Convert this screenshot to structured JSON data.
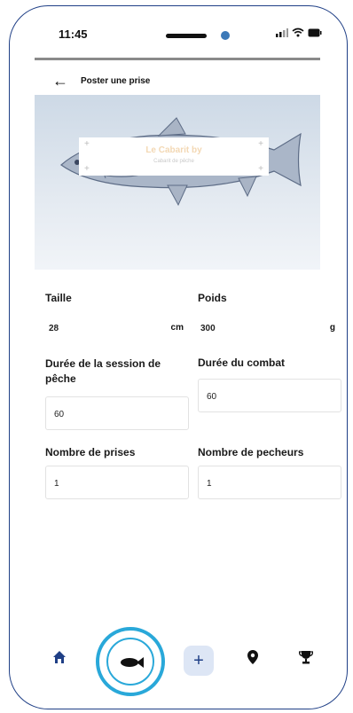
{
  "status_bar": {
    "time": "11:45"
  },
  "header": {
    "title": "Poster une prise"
  },
  "hero": {
    "logo_text": "Le Cabarit by",
    "logo_sub": "Cabarit de pêche"
  },
  "form": {
    "taille": {
      "label": "Taille",
      "value": "28",
      "unit": "cm"
    },
    "poids": {
      "label": "Poids",
      "value": "300",
      "unit": "g"
    },
    "duree_session": {
      "label": "Durée de la session de pêche",
      "value": "60"
    },
    "duree_combat": {
      "label": "Durée du combat",
      "value": "60"
    },
    "nombre_prises": {
      "label": "Nombre de prises",
      "value": "1"
    },
    "nombre_pecheurs": {
      "label": "Nombre de pecheurs",
      "value": "1"
    }
  },
  "nav": {
    "items": [
      "home-icon",
      "fish-icon",
      "add-icon",
      "location-pin-icon",
      "trophy-icon"
    ],
    "active": "fish-icon",
    "accent": "#29a8d9",
    "primary": "#1f3f86"
  }
}
